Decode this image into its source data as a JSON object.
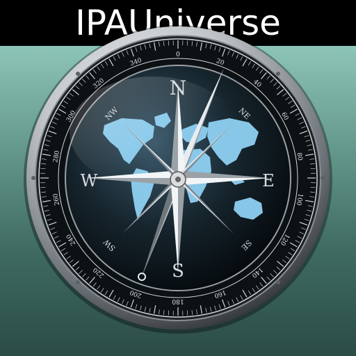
{
  "banner": {
    "title": "IPAUniverse"
  },
  "compass": {
    "cardinals": {
      "north": "N",
      "east": "E",
      "south": "S",
      "west": "W"
    },
    "intercardinals": {
      "ne": "NE",
      "se": "SE",
      "sw": "SW",
      "nw": "NW"
    },
    "degree_labels": [
      "0",
      "20",
      "40",
      "60",
      "80",
      "100",
      "120",
      "140",
      "160",
      "180",
      "200",
      "220",
      "240",
      "260",
      "280",
      "300",
      "320",
      "340"
    ],
    "colors": {
      "map": "#8fd0f2",
      "dial_dark": "#0b1418",
      "bezel": "#c9ccd0",
      "needle_light": "#eef2f5"
    }
  },
  "icon": "compass-icon"
}
